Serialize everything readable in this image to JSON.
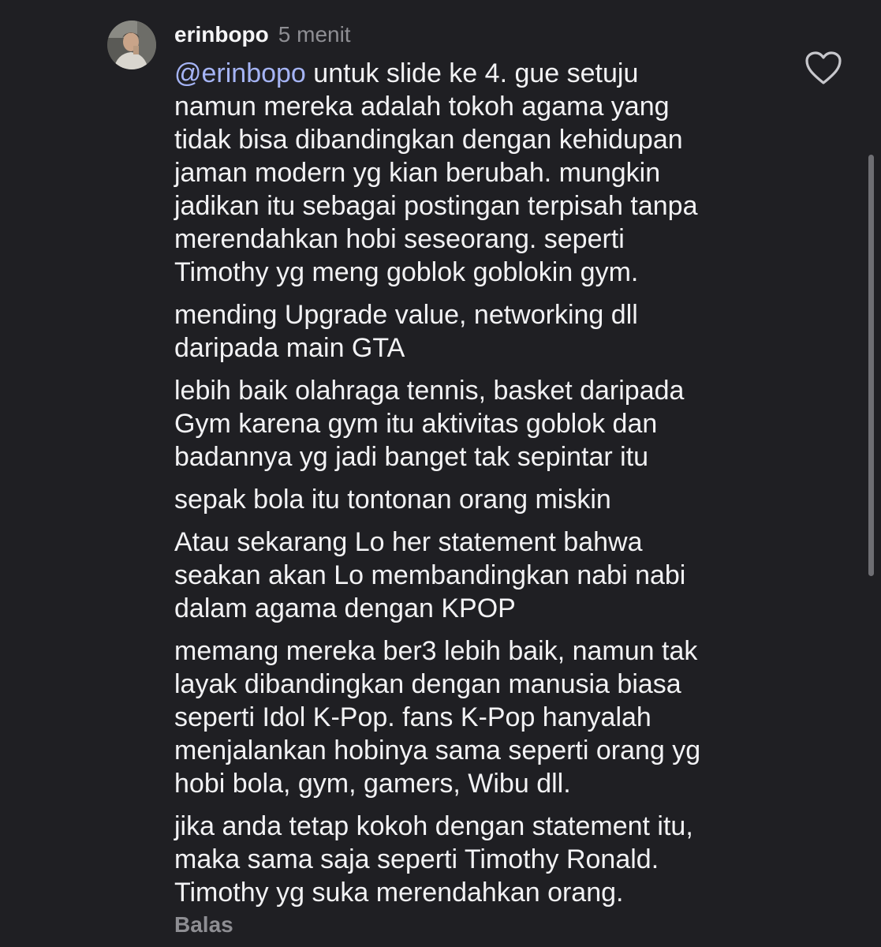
{
  "comment": {
    "username": "erinbopo",
    "time": "5 menit",
    "paragraphs": [
      {
        "mention": "@erinbopo",
        "lines": [
          " untuk slide ke 4. gue setuju",
          "namun mereka adalah tokoh agama yang",
          "tidak bisa dibandingkan dengan kehidupan",
          "jaman modern yg kian berubah. mungkin",
          "jadikan itu sebagai postingan terpisah tanpa",
          "merendahkan hobi seseorang. seperti",
          "Timothy yg meng goblok goblokin gym."
        ]
      },
      {
        "lines": [
          "mending Upgrade value, networking dll",
          "daripada main GTA"
        ]
      },
      {
        "lines": [
          "lebih baik olahraga tennis, basket daripada",
          "Gym karena gym itu aktivitas goblok dan",
          "badannya yg jadi banget tak sepintar itu"
        ]
      },
      {
        "lines": [
          "sepak bola itu tontonan orang miskin"
        ]
      },
      {
        "lines": [
          "Atau sekarang Lo her statement bahwa",
          "seakan akan Lo membandingkan nabi nabi",
          "dalam agama dengan KPOP"
        ]
      },
      {
        "lines": [
          "memang mereka ber3 lebih baik, namun tak",
          "layak dibandingkan dengan manusia biasa",
          "seperti Idol K-Pop. fans K-Pop hanyalah",
          "menjalankan hobinya sama seperti orang yg",
          "hobi bola, gym, gamers, Wibu dll."
        ]
      },
      {
        "lines": [
          "jika anda tetap kokoh dengan statement itu,",
          "maka sama saja seperti Timothy Ronald.",
          "Timothy yg suka merendahkan orang."
        ]
      }
    ],
    "reply_label": "Balas"
  },
  "icons": {
    "like": "heart-outline-icon",
    "avatar": "profile-photo"
  },
  "colors": {
    "background": "#1f1f23",
    "text": "#f2f2f4",
    "muted": "#8e8e93",
    "mention": "#a5b4f5"
  }
}
